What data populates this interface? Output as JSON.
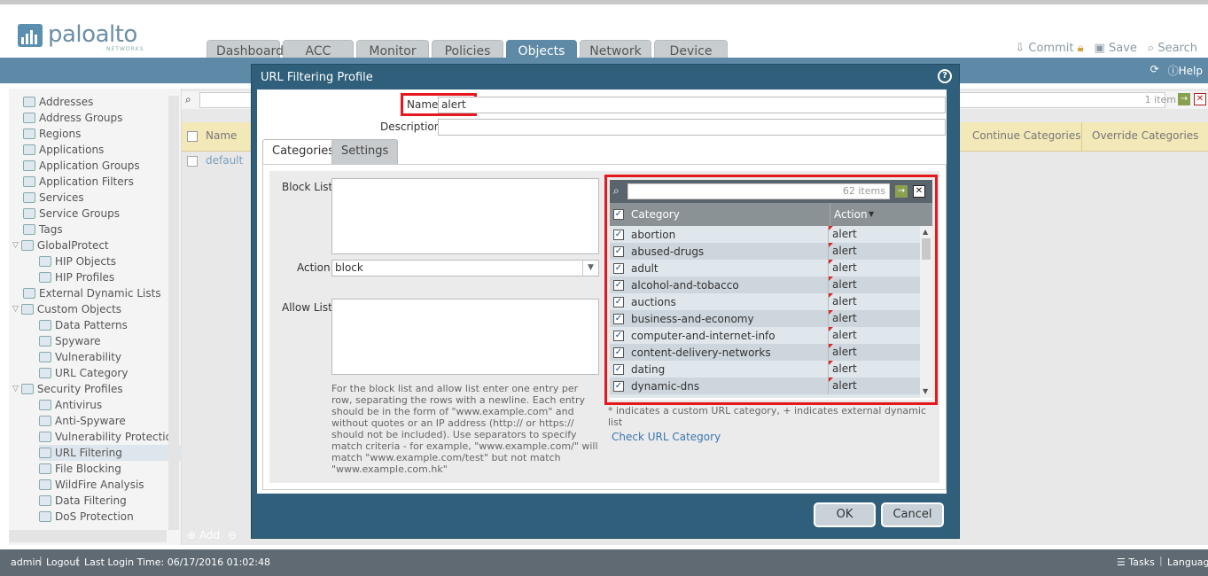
{
  "app": {
    "logo_text": "paloalto",
    "logo_sub": "NETWORKS"
  },
  "tabs": [
    "Dashboard",
    "ACC",
    "Monitor",
    "Policies",
    "Objects",
    "Network",
    "Device"
  ],
  "active_tab": "Objects",
  "toplinks": {
    "commit": "Commit",
    "save": "Save",
    "search": "Search"
  },
  "bluebar": {
    "help": "Help"
  },
  "tree": [
    {
      "label": "Addresses",
      "indent": 0
    },
    {
      "label": "Address Groups",
      "indent": 0
    },
    {
      "label": "Regions",
      "indent": 0
    },
    {
      "label": "Applications",
      "indent": 0
    },
    {
      "label": "Application Groups",
      "indent": 0
    },
    {
      "label": "Application Filters",
      "indent": 0
    },
    {
      "label": "Services",
      "indent": 0
    },
    {
      "label": "Service Groups",
      "indent": 0
    },
    {
      "label": "Tags",
      "indent": 0
    },
    {
      "label": "GlobalProtect",
      "indent": 0,
      "expand": true
    },
    {
      "label": "HIP Objects",
      "indent": 1
    },
    {
      "label": "HIP Profiles",
      "indent": 1
    },
    {
      "label": "External Dynamic Lists",
      "indent": 0
    },
    {
      "label": "Custom Objects",
      "indent": 0,
      "expand": true
    },
    {
      "label": "Data Patterns",
      "indent": 1
    },
    {
      "label": "Spyware",
      "indent": 1
    },
    {
      "label": "Vulnerability",
      "indent": 1
    },
    {
      "label": "URL Category",
      "indent": 1
    },
    {
      "label": "Security Profiles",
      "indent": 0,
      "expand": true
    },
    {
      "label": "Antivirus",
      "indent": 1
    },
    {
      "label": "Anti-Spyware",
      "indent": 1
    },
    {
      "label": "Vulnerability Protection",
      "indent": 1
    },
    {
      "label": "URL Filtering",
      "indent": 1,
      "selected": true
    },
    {
      "label": "File Blocking",
      "indent": 1
    },
    {
      "label": "WildFire Analysis",
      "indent": 1
    },
    {
      "label": "Data Filtering",
      "indent": 1
    },
    {
      "label": "DoS Protection",
      "indent": 1
    }
  ],
  "grid": {
    "count": "1 item",
    "col_name": "Name",
    "col_continue": "Continue Categories",
    "col_override": "Override Categories",
    "row_name": "default",
    "add": "Add"
  },
  "status": {
    "user": "admin",
    "logout": "Logout",
    "last_login": "Last Login Time: 06/17/2016 01:02:48",
    "tasks": "Tasks",
    "language": "Language"
  },
  "dialog": {
    "title": "URL Filtering Profile",
    "name_label": "Name",
    "name_value": "alert",
    "desc_label": "Description",
    "desc_value": "",
    "tabs": [
      "Categories",
      "Settings"
    ],
    "block_list_label": "Block List",
    "action_label": "Action",
    "action_value": "block",
    "allow_list_label": "Allow List",
    "help_text": "For the block list and allow list enter one entry per row, separating the rows with a newline. Each entry should be in the form of \"www.example.com\" and without quotes or an IP address (http:// or https:// should not be included). Use separators to specify match criteria - for example, \"www.example.com/\" will match \"www.example.com/test\" but not match \"www.example.com.hk\"",
    "items_count": "62 items",
    "col_category": "Category",
    "col_action": "Action",
    "categories": [
      {
        "name": "abortion",
        "action": "alert"
      },
      {
        "name": "abused-drugs",
        "action": "alert"
      },
      {
        "name": "adult",
        "action": "alert"
      },
      {
        "name": "alcohol-and-tobacco",
        "action": "alert"
      },
      {
        "name": "auctions",
        "action": "alert"
      },
      {
        "name": "business-and-economy",
        "action": "alert"
      },
      {
        "name": "computer-and-internet-info",
        "action": "alert"
      },
      {
        "name": "content-delivery-networks",
        "action": "alert"
      },
      {
        "name": "dating",
        "action": "alert"
      },
      {
        "name": "dynamic-dns",
        "action": "alert"
      }
    ],
    "footnote": "* indicates a custom URL category, + indicates external dynamic list",
    "check_link": "Check URL Category",
    "ok": "OK",
    "cancel": "Cancel"
  },
  "colors": {
    "accent": "#5f8aa7",
    "dialog": "#2f5f7a",
    "highlight": "#e5181e"
  }
}
